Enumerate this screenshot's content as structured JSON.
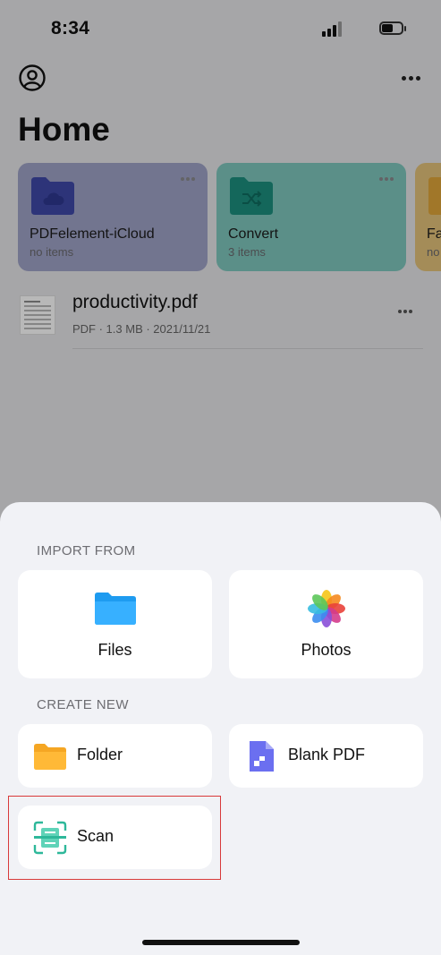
{
  "status_bar": {
    "time": "8:34"
  },
  "home": {
    "title": "Home",
    "folders": [
      {
        "name": "PDFelement-iCloud",
        "count": "no items",
        "color": "#3f49a8",
        "bg": "#9fa2c6"
      },
      {
        "name": "Convert",
        "count": "3 items",
        "color": "#1d8f7f",
        "bg": "#7fc7bd"
      },
      {
        "name": "Fa",
        "count": "no",
        "color": "#e0a53a",
        "bg": "#e3c27a"
      }
    ],
    "files": [
      {
        "name": "productivity.pdf",
        "meta": "PDF · 1.3 MB · 2021/11/21"
      }
    ]
  },
  "sheet": {
    "import_title": "IMPORT FROM",
    "import_items": [
      "Files",
      "Photos"
    ],
    "create_title": "CREATE NEW",
    "create_items": [
      "Folder",
      "Blank PDF",
      "Scan"
    ]
  },
  "colors": {
    "highlight": "#d83a3a",
    "files_blue": "#1e9bf0",
    "folder_orange": "#f5a623",
    "pdf_purple": "#6b6ff0",
    "scan_teal": "#2eb89a"
  }
}
